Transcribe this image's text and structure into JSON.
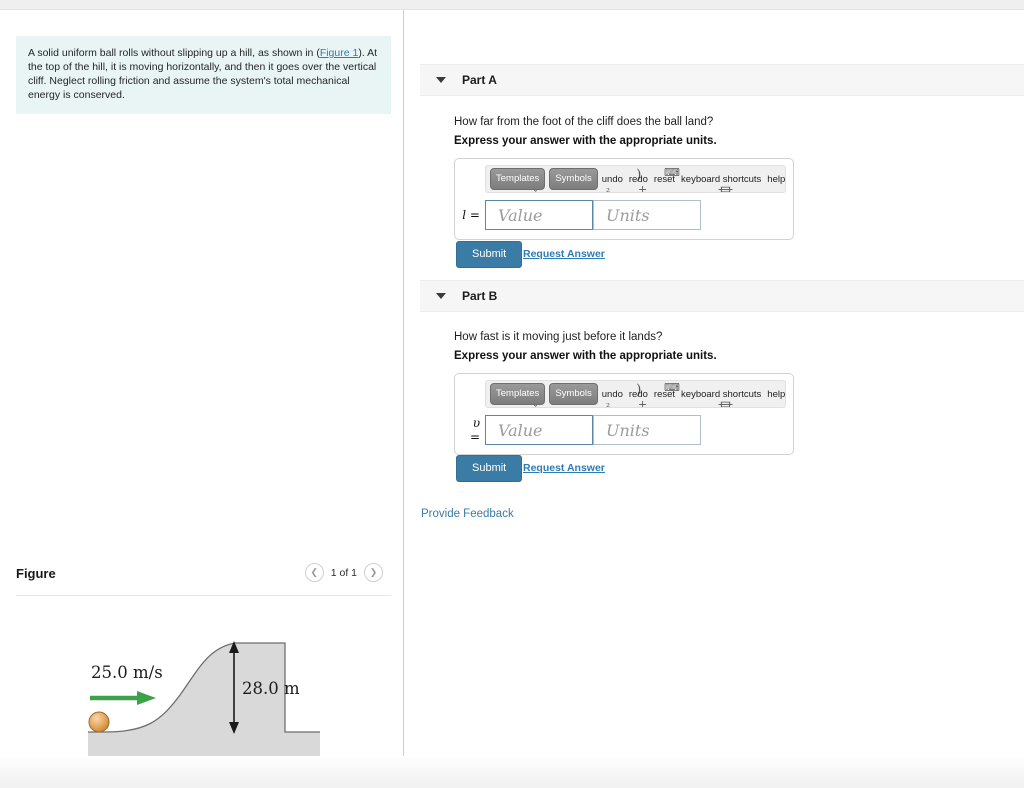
{
  "problem": {
    "text_before_link": "A solid uniform ball rolls without slipping up a hill, as shown in (",
    "figure_link": "Figure 1",
    "text_after_link": "). At the top of the hill, it is moving horizontally, and then it goes over the vertical cliff. Neglect rolling friction and assume the system's total mechanical energy is conserved."
  },
  "figure_panel": {
    "title": "Figure",
    "counter": "1 of 1",
    "prev_icon": "chevron-left-icon",
    "next_icon": "chevron-right-icon",
    "diagram": {
      "velocity_label": "25.0 m/s",
      "height_label": "28.0 m",
      "ball_color": "#e3a45f",
      "arrow_color": "#3aa34a",
      "hill_fill": "#d9d9d9",
      "hill_stroke": "#6e6e6e",
      "ground_fill": "#ececec"
    }
  },
  "parts": [
    {
      "id": "part-a",
      "label": "Part A",
      "question": "How far from the foot of the cliff does the ball land?",
      "express": "Express your answer with the appropriate units.",
      "variable": "l =",
      "value_placeholder": "Value",
      "units_placeholder": "Units",
      "value_text": "Value",
      "units_text": "Units",
      "submit_label": "Submit",
      "request_answer_label": "Request Answer"
    },
    {
      "id": "part-b",
      "label": "Part B",
      "question": "How fast is it moving just before it lands?",
      "express": "Express your answer with the appropriate units.",
      "variable": "υ =",
      "value_placeholder": "Value",
      "units_placeholder": "Units",
      "value_text": "Value",
      "units_text": "Units",
      "submit_label": "Submit",
      "request_answer_label": "Request Answer"
    }
  ],
  "toolbar": {
    "templates_label": "Templates",
    "symbols_label": "Symbols",
    "undo_label": "undo",
    "redo_label": "redo",
    "reset_label": "reset",
    "shortcuts_label": "keyboard shortcuts",
    "help_label": "help",
    "ghost_glyphs": [
      "↶",
      "(",
      "‾",
      ")",
      "⌨",
      "∿",
      "₀",
      "₁",
      "⌓"
    ]
  },
  "provide_feedback": "Provide Feedback",
  "colors": {
    "accent_blue": "#3a7ca5",
    "link_blue": "#2e7cb5",
    "problem_bg": "#e9f4f4",
    "part_header_bg": "#f6f6f6"
  }
}
